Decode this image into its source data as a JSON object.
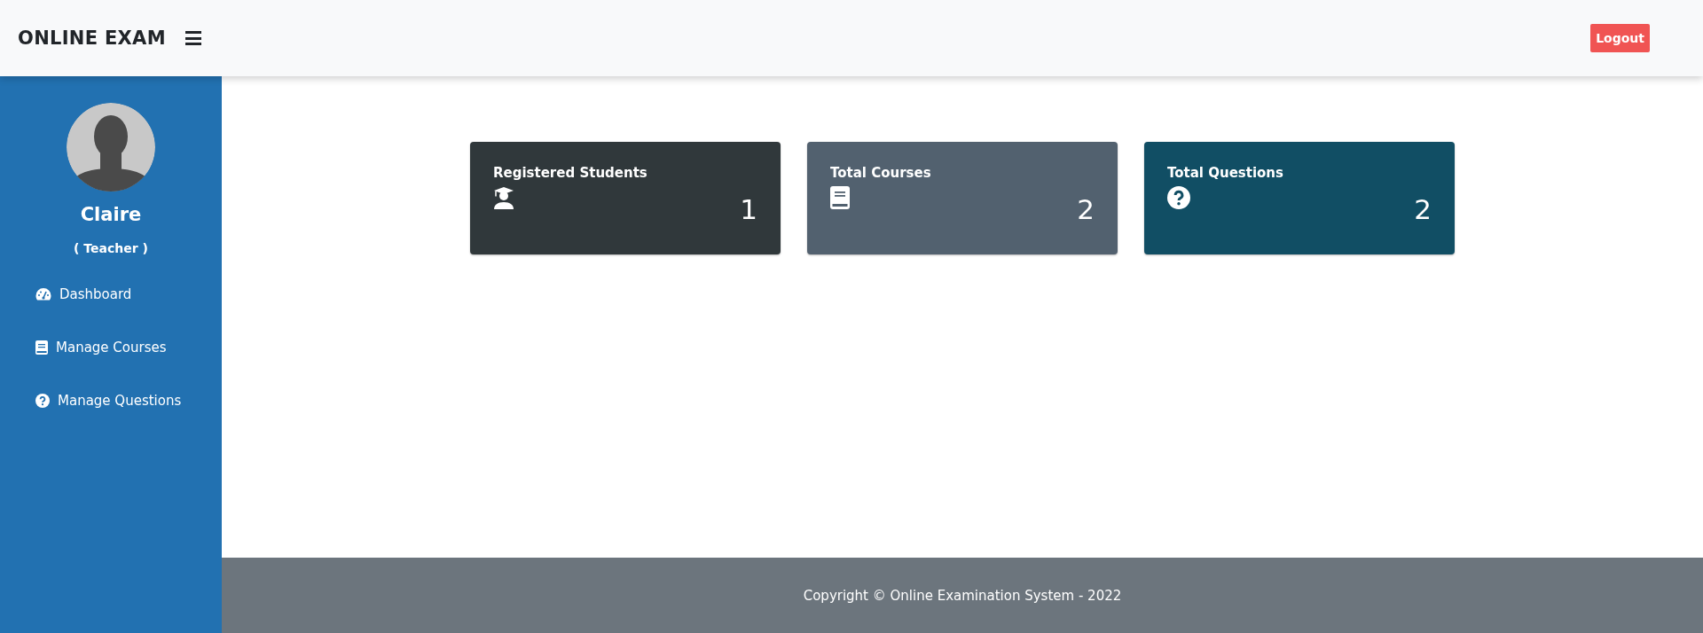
{
  "header": {
    "brand": "ONLINE EXAM",
    "logout": "Logout"
  },
  "sidebar": {
    "user_name": "Claire",
    "role": "( Teacher )",
    "items": [
      {
        "label": "Dashboard"
      },
      {
        "label": "Manage Courses"
      },
      {
        "label": "Manage Questions"
      }
    ]
  },
  "cards": [
    {
      "title": "Registered Students",
      "value": "1",
      "color": "#30383b"
    },
    {
      "title": "Total Courses",
      "value": "2",
      "color": "#52616f"
    },
    {
      "title": "Total Questions",
      "value": "2",
      "color": "#114e64"
    }
  ],
  "footer": {
    "text": "Copyright © Online Examination System - 2022"
  }
}
